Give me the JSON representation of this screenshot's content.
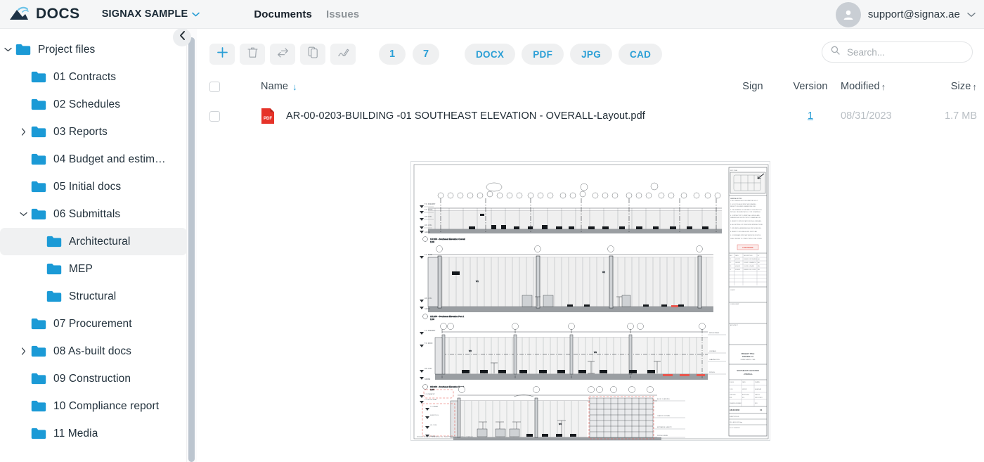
{
  "header": {
    "logo_text": "DOCS",
    "logo_icon": "signax-mountain-logo-icon",
    "project_name": "SIGNAX SAMPLE",
    "project_chevron_icon": "chevron-down-icon",
    "tabs": [
      {
        "label": "Documents",
        "active": true
      },
      {
        "label": "Issues",
        "active": false
      }
    ],
    "user": {
      "email": "support@signax.ae",
      "avatar_icon": "user-avatar-icon",
      "chevron_icon": "chevron-down-icon"
    }
  },
  "sidebar": {
    "collapse_icon": "chevron-left-icon",
    "items": [
      {
        "label": "Project files",
        "depth": 0,
        "twisty": "expanded",
        "selected": false
      },
      {
        "label": "01 Contracts",
        "depth": 1,
        "twisty": "none",
        "selected": false
      },
      {
        "label": "02 Schedules",
        "depth": 1,
        "twisty": "none",
        "selected": false
      },
      {
        "label": "03 Reports",
        "depth": 1,
        "twisty": "collapsed",
        "selected": false
      },
      {
        "label": "04 Budget and estim…",
        "depth": 1,
        "twisty": "none",
        "selected": false
      },
      {
        "label": "05 Initial docs",
        "depth": 1,
        "twisty": "none",
        "selected": false
      },
      {
        "label": "06 Submittals",
        "depth": 1,
        "twisty": "expanded",
        "selected": false
      },
      {
        "label": "Architectural",
        "depth": 2,
        "twisty": "none",
        "selected": true
      },
      {
        "label": "MEP",
        "depth": 2,
        "twisty": "none",
        "selected": false
      },
      {
        "label": "Structural",
        "depth": 2,
        "twisty": "none",
        "selected": false
      },
      {
        "label": "07 Procurement",
        "depth": 1,
        "twisty": "none",
        "selected": false
      },
      {
        "label": "08 As-built docs",
        "depth": 1,
        "twisty": "collapsed",
        "selected": false
      },
      {
        "label": "09 Construction",
        "depth": 1,
        "twisty": "none",
        "selected": false
      },
      {
        "label": "10 Compliance report",
        "depth": 1,
        "twisty": "none",
        "selected": false
      },
      {
        "label": "11 Media",
        "depth": 1,
        "twisty": "none",
        "selected": false
      }
    ]
  },
  "toolbar": {
    "actions": [
      {
        "icon": "plus-icon",
        "name": "add-button"
      },
      {
        "icon": "trash-icon",
        "name": "delete-button"
      },
      {
        "icon": "move-icon",
        "name": "move-button"
      },
      {
        "icon": "copy-icon",
        "name": "copy-button"
      },
      {
        "icon": "rename-icon",
        "name": "rename-button"
      }
    ],
    "count_chips": [
      "1",
      "7"
    ],
    "type_chips": [
      "DOCX",
      "PDF",
      "JPG",
      "CAD"
    ],
    "search": {
      "placeholder": "Search...",
      "value": "",
      "icon": "search-icon"
    }
  },
  "table": {
    "columns": [
      {
        "key": "name",
        "label": "Name",
        "sort": "down"
      },
      {
        "key": "sign",
        "label": "Sign",
        "sort": "none"
      },
      {
        "key": "version",
        "label": "Version",
        "sort": "none"
      },
      {
        "key": "modified",
        "label": "Modified",
        "sort": "up"
      },
      {
        "key": "size",
        "label": "Size",
        "sort": "up"
      }
    ],
    "rows": [
      {
        "checked": false,
        "file_icon": "pdf-file-icon",
        "file_icon_label": "PDF",
        "name": "AR-00-0203-BUILDING -01 SOUTHEAST ELEVATION - OVERALL-Layout.pdf",
        "sign": "",
        "version": "1",
        "modified": "08/31/2023",
        "size": "1.7 MB"
      }
    ]
  },
  "preview": {
    "document_type": "architectural-elevation-drawing",
    "title": "AR-00-0203-BUILDING -01 SOUTHEAST ELEVATION - OVERALL-Layout.pdf"
  },
  "colors": {
    "accent": "#2b9fd6",
    "folder": "#1b9ad6",
    "header_bg": "#f5f6f7",
    "pdf_red": "#e63329",
    "text": "#22313c",
    "muted": "#b9bfc4"
  }
}
